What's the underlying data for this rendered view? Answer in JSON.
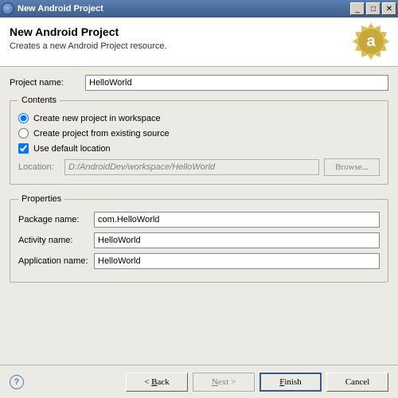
{
  "window": {
    "title": "New Android Project"
  },
  "header": {
    "title": "New Android Project",
    "desc": "Creates a new Android Project resource.",
    "badge_letter": "a"
  },
  "project": {
    "label": "Project name:",
    "value": "HelloWorld"
  },
  "contents": {
    "legend": "Contents",
    "radio_new": "Create new project in workspace",
    "radio_existing": "Create project from existing source",
    "use_default": "Use default location",
    "location_label": "Location:",
    "location_value": "D:/AndroidDev/workspace/HelloWorld",
    "browse": "Browse..."
  },
  "properties": {
    "legend": "Properties",
    "package_label": "Package name:",
    "package_value": "com.HelloWorld",
    "activity_label": "Activity name:",
    "activity_value": "HelloWorld",
    "app_label": "Application name:",
    "app_value": "HelloWorld"
  },
  "buttons": {
    "back": "Back",
    "next": "Next",
    "finish": "Finish",
    "cancel": "Cancel"
  }
}
